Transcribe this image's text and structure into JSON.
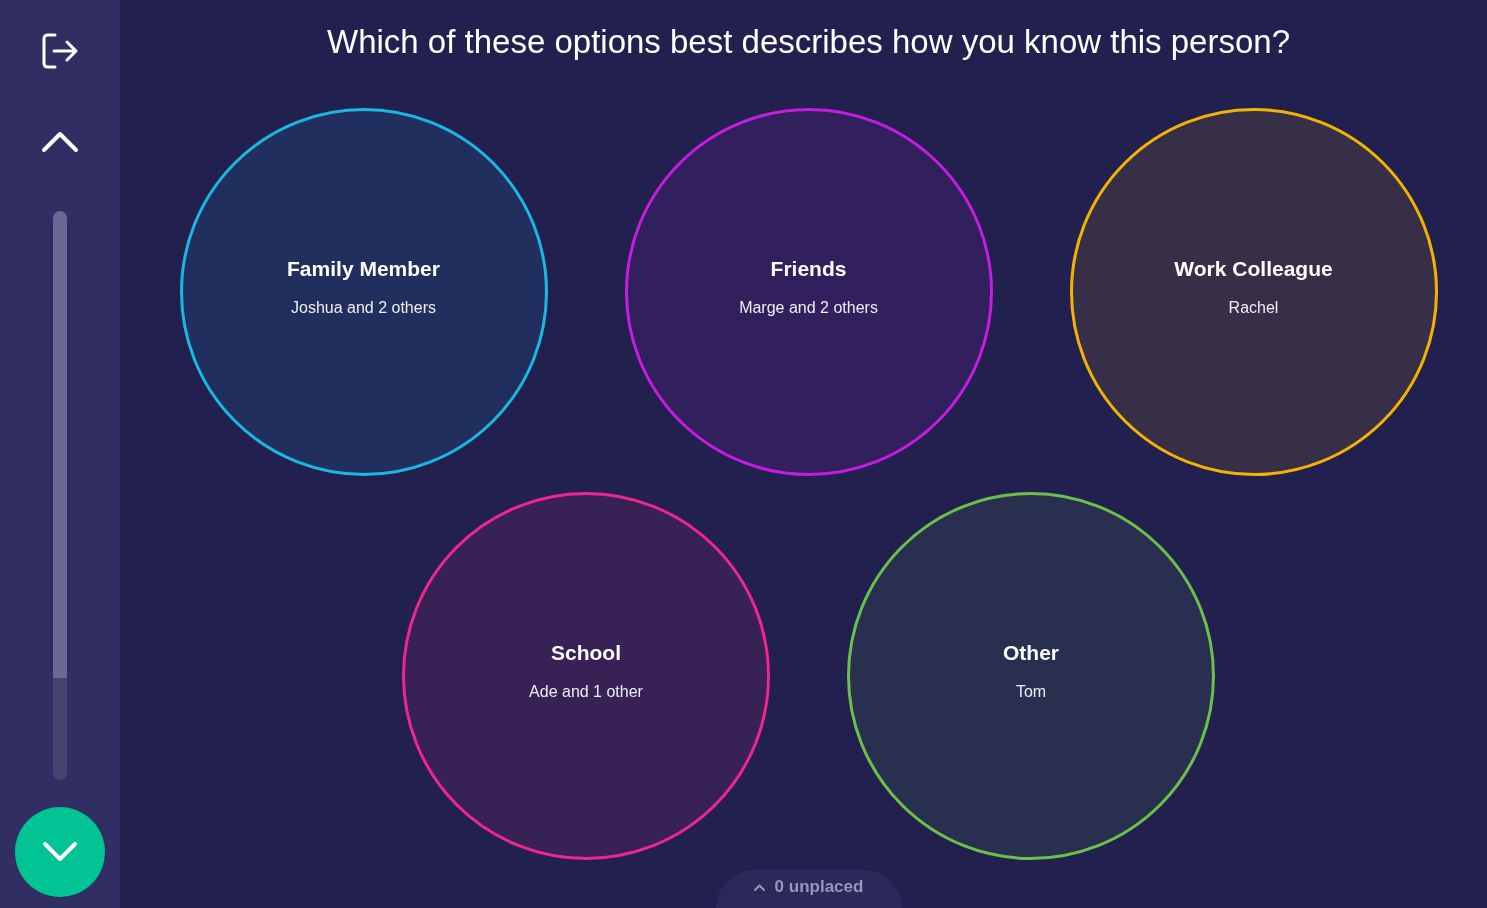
{
  "navigation": {
    "progress": {
      "level": 0.82
    }
  },
  "question": "Which of these options best describes how you know this person?",
  "categories": [
    {
      "label": "Family Member",
      "members": "Joshua and 2 others",
      "color": "#1ab8e0"
    },
    {
      "label": "Friends",
      "members": "Marge and 2 others",
      "color": "#c51de0"
    },
    {
      "label": "Work Colleague",
      "members": "Rachel",
      "color": "#f2b400"
    },
    {
      "label": "School",
      "members": "Ade and 1 other",
      "color": "#f0268f"
    },
    {
      "label": "Other",
      "members": "Tom",
      "color": "#6cc04a"
    }
  ],
  "unplaced": {
    "label": "0 unplaced"
  }
}
